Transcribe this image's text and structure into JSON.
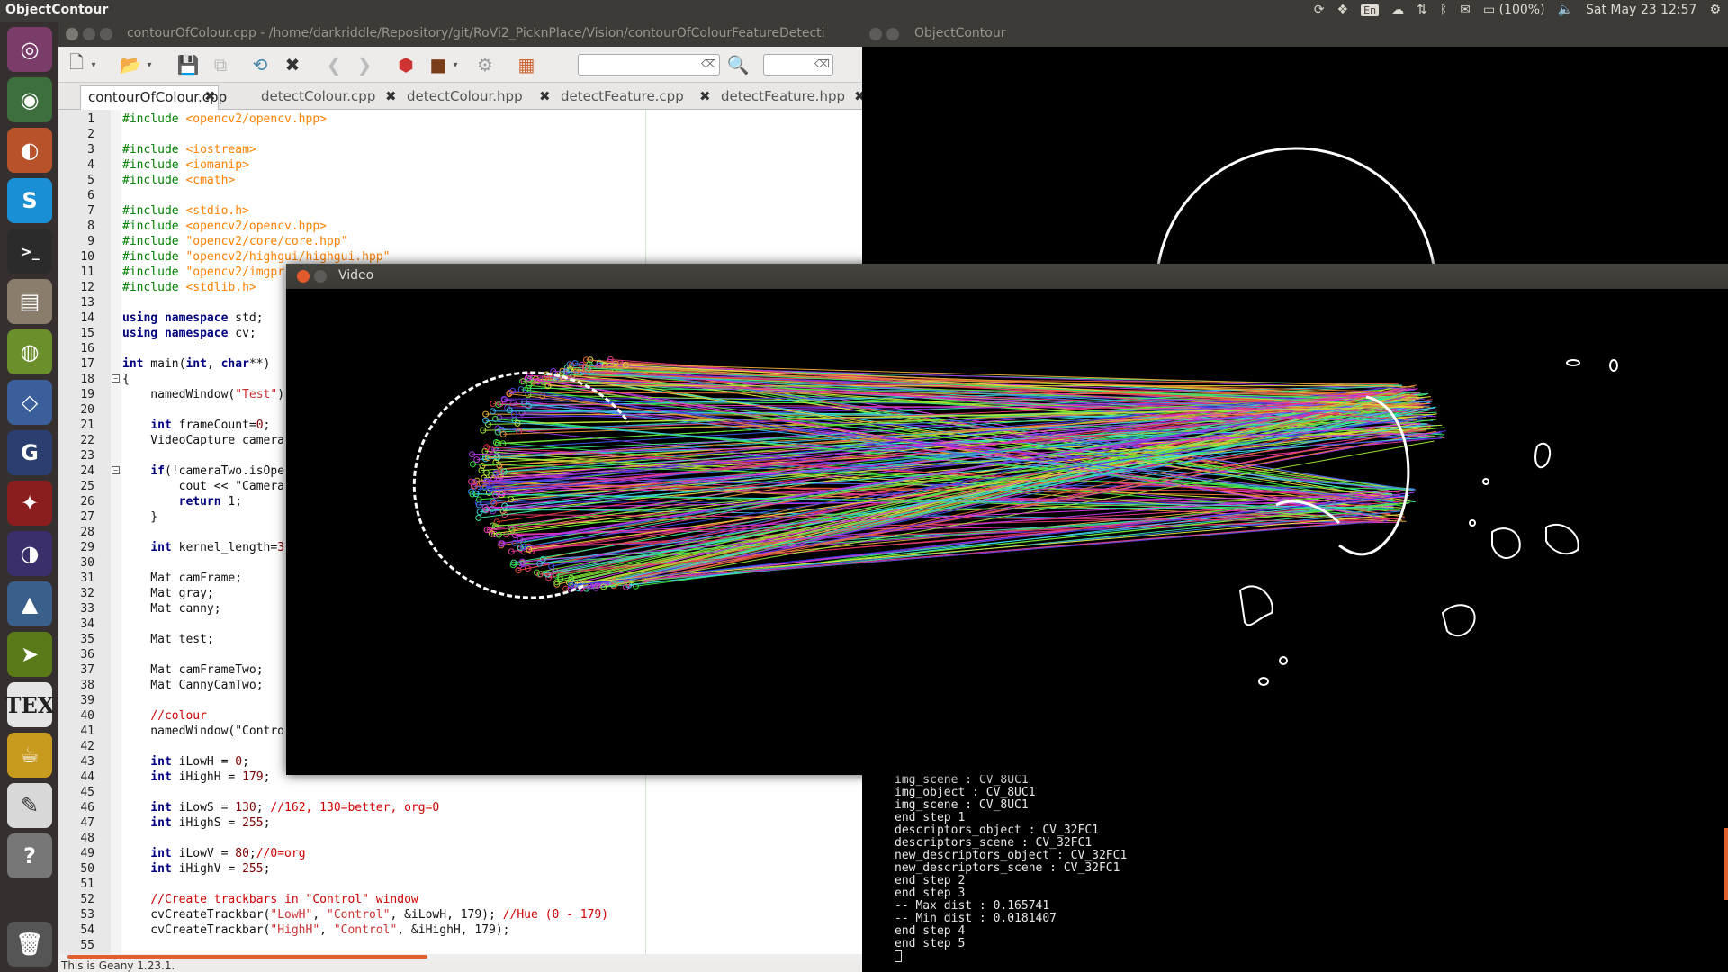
{
  "top_panel": {
    "app_title": "ObjectContour",
    "lang": "En",
    "battery": "(100%)",
    "datetime": "Sat May 23  12:57"
  },
  "launcher": {
    "items": [
      "dash-icon",
      "chrome-icon",
      "firefox-icon",
      "skype-icon",
      "terminal-icon",
      "files-icon",
      "android-icon",
      "virtualbox-icon",
      "geany-icon",
      "red-bird-icon",
      "eclipse-icon",
      "matlab-icon",
      "arrow-app-icon",
      "tex-icon",
      "teapot-icon",
      "text-editor-icon",
      "help-icon",
      "trash-icon"
    ]
  },
  "geany": {
    "window_title": "contourOfColour.cpp - /home/darkriddle/Repository/git/RoVi2_PicknPlace/Vision/contourOfColourFeatureDetecti",
    "tabs": [
      {
        "label": "contourOfColour.cpp",
        "active": true
      },
      {
        "label": "detectColour.cpp"
      },
      {
        "label": "detectColour.hpp"
      },
      {
        "label": "detectFeature.cpp"
      },
      {
        "label": "detectFeature.hpp"
      }
    ],
    "status": "This is Geany 1.23.1.",
    "code": [
      "#include <opencv2/opencv.hpp>",
      "",
      "#include <iostream>",
      "#include <iomanip>",
      "#include <cmath>",
      "",
      "#include <stdio.h>",
      "#include <opencv2/opencv.hpp>",
      "#include \"opencv2/core/core.hpp\"",
      "#include \"opencv2/highgui/highgui.hpp\"",
      "#include \"opencv2/imgpr",
      "#include <stdlib.h>",
      "",
      "using namespace std;",
      "using namespace cv;",
      "",
      "int main(int, char**)",
      "{",
      "    namedWindow(\"Test\")",
      "",
      "    int frameCount=0;",
      "    VideoCapture camera",
      "",
      "    if(!cameraTwo.isOpe",
      "        cout << \"Camera",
      "        return 1;",
      "    }",
      "",
      "    int kernel_length=3",
      "",
      "    Mat camFrame;",
      "    Mat gray;",
      "    Mat canny;",
      "",
      "    Mat test;",
      "",
      "    Mat camFrameTwo;",
      "    Mat CannyCamTwo;",
      "",
      "    //colour",
      "    namedWindow(\"Contro",
      "",
      "    int iLowH = 0;",
      "    int iHighH = 179;",
      "",
      "    int iLowS = 130; //162, 130=better, org=0",
      "    int iHighS = 255;",
      "",
      "    int iLowV = 80;//0=org",
      "    int iHighV = 255;",
      "",
      "    //Create trackbars in \"Control\" window",
      "    cvCreateTrackbar(\"LowH\", \"Control\", &iLowH, 179); //Hue (0 - 179)",
      "    cvCreateTrackbar(\"HighH\", \"Control\", &iHighH, 179);",
      ""
    ]
  },
  "object_contour": {
    "window_title": "ObjectContour"
  },
  "video": {
    "window_title": "Video"
  },
  "terminal": {
    "lines": [
      "img_scene : CV_8UC1",
      "img_object : CV_8UC1",
      "img_scene : CV_8UC1",
      "end step 1",
      "descriptors_object : CV_32FC1",
      "descriptors_scene : CV_32FC1",
      "new_descriptors_object : CV_32FC1",
      "new_descriptors_scene : CV_32FC1",
      "end step 2",
      "end step 3",
      "-- Max dist : 0.165741",
      "-- Min dist : 0.0181407",
      "end step 4",
      "end step 5"
    ]
  }
}
